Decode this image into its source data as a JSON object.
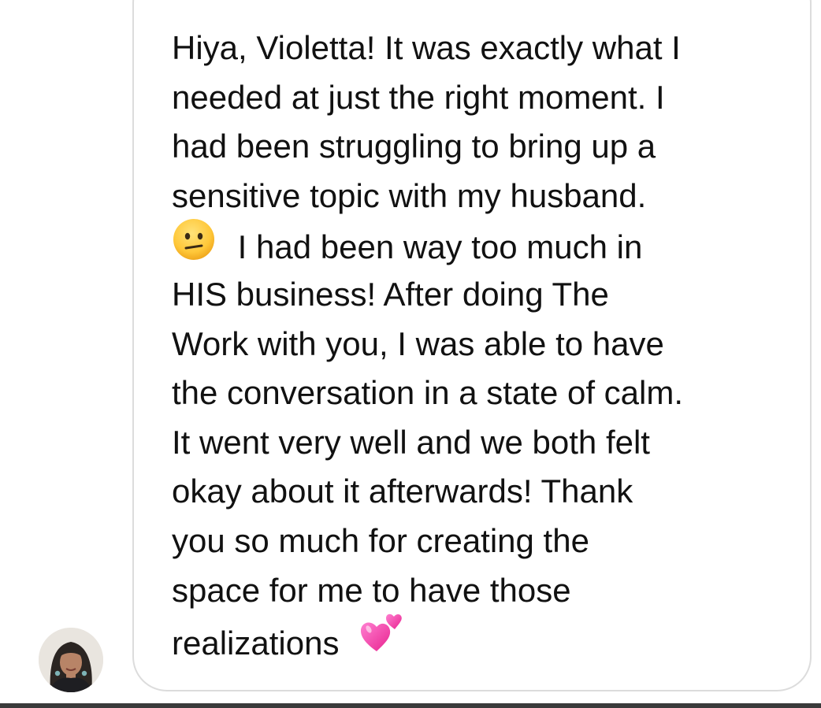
{
  "message": {
    "sender": "contact",
    "lines": [
      "Hiya, Violetta! It was exactly what I",
      "needed at just the right moment. I",
      "had been struggling to bring up a",
      "sensitive topic with my husband.",
      "I had been way too much in",
      "HIS business! After doing The",
      "Work with you, I was able to have",
      "the conversation in a state of calm.",
      "It went very well and we both felt",
      "okay about it afterwards! Thank",
      "you so much for creating the",
      "space for me to have those",
      "realizations"
    ],
    "emojis": {
      "confused": "confused-face-icon",
      "hearts": "two-hearts-icon"
    }
  },
  "colors": {
    "bubble_border": "#dcdcdc",
    "text": "#111111",
    "background": "#ffffff"
  }
}
